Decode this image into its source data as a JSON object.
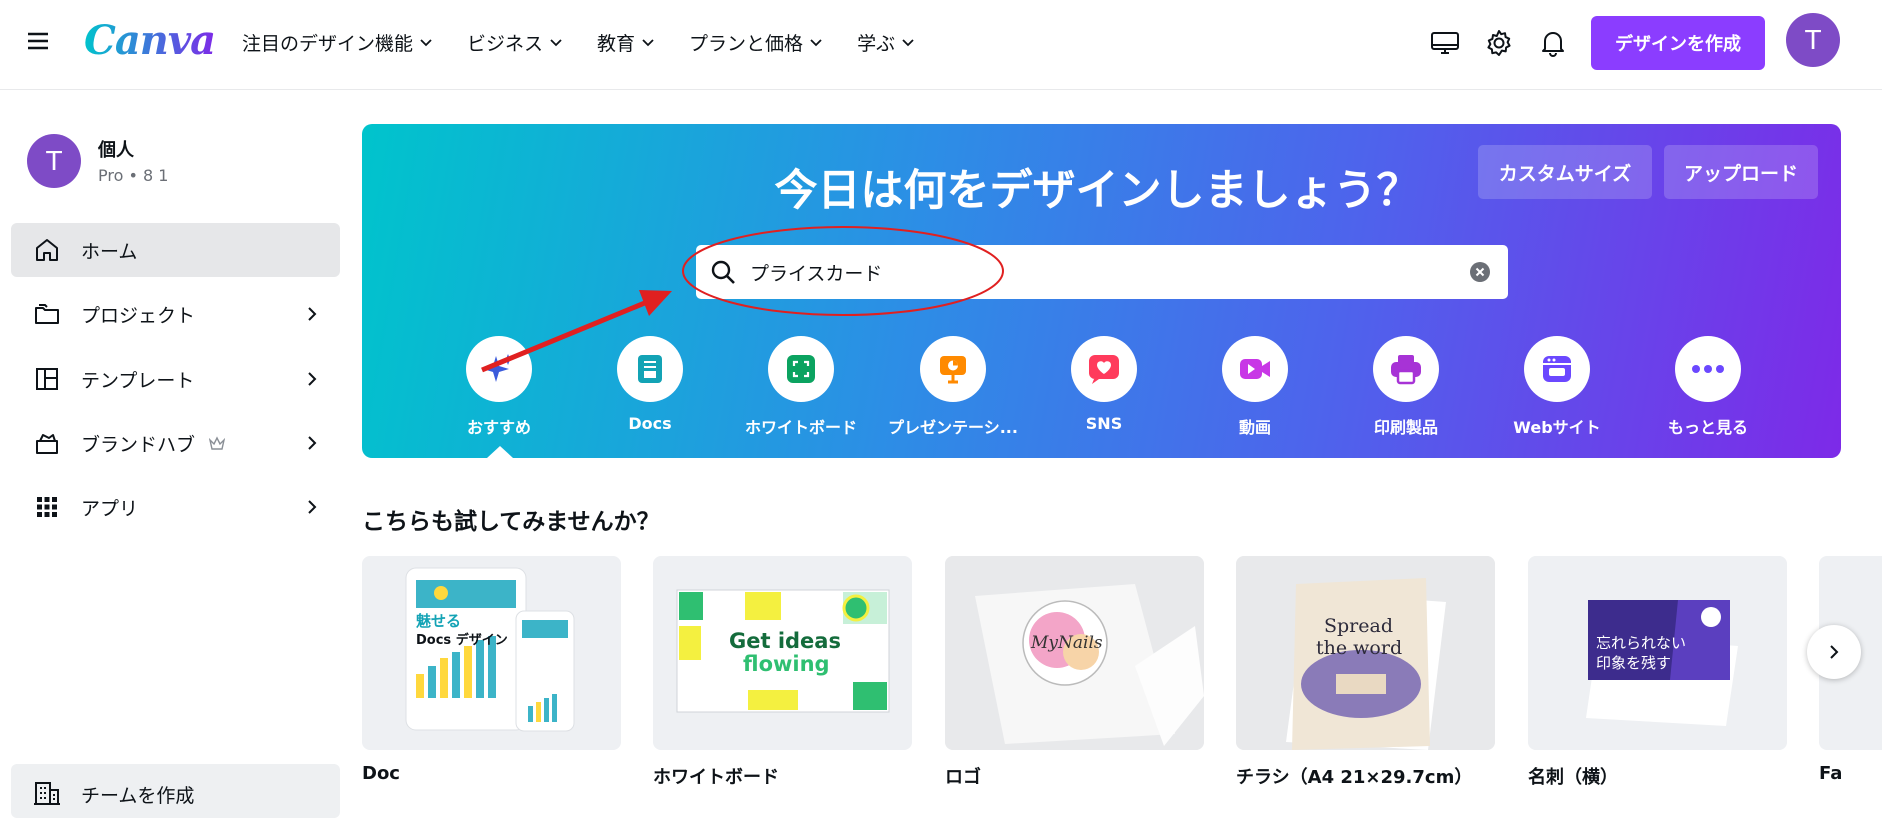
{
  "header": {
    "logo": "Canva",
    "nav": [
      "注目のデザイン機能",
      "ビジネス",
      "教育",
      "プランと価格",
      "学ぶ"
    ],
    "create_button": "デザインを作成",
    "avatar_initial": "T"
  },
  "sidebar": {
    "account": {
      "initial": "T",
      "name": "個人",
      "plan": "Pro • 8 1"
    },
    "items": [
      {
        "label": "ホーム",
        "icon": "home-icon",
        "active": true
      },
      {
        "label": "プロジェクト",
        "icon": "folder-icon"
      },
      {
        "label": "テンプレート",
        "icon": "template-icon"
      },
      {
        "label": "ブランドハブ",
        "icon": "brand-hub-icon"
      },
      {
        "label": "アプリ",
        "icon": "apps-grid-icon"
      }
    ],
    "team_button": "チームを作成"
  },
  "hero": {
    "title": "今日は何をデザインしましょう？",
    "custom_size": "カスタムサイズ",
    "upload": "アップロード",
    "search_value": "プライスカード",
    "categories": [
      {
        "label": "おすすめ",
        "color": "#3b5bdb",
        "icon": "sparkle-icon"
      },
      {
        "label": "Docs",
        "color": "#13a3b5",
        "icon": "docs-icon"
      },
      {
        "label": "ホワイトボード",
        "color": "#0ba360",
        "icon": "whiteboard-icon"
      },
      {
        "label": "プレゼンテーシ...",
        "color": "#ff8a00",
        "icon": "presentation-icon"
      },
      {
        "label": "SNS",
        "color": "#ff3b5c",
        "icon": "heart-icon"
      },
      {
        "label": "動画",
        "color": "#c837e6",
        "icon": "video-icon"
      },
      {
        "label": "印刷製品",
        "color": "#a733d6",
        "icon": "printer-icon"
      },
      {
        "label": "Webサイト",
        "color": "#6b48ff",
        "icon": "browser-icon"
      },
      {
        "label": "もっと見る",
        "color": "#6b48ff",
        "icon": "more-icon"
      }
    ]
  },
  "suggestions": {
    "title": "こちらも試してみませんか？",
    "cards": [
      {
        "label": "Doc",
        "thumb_title": "魅せる",
        "thumb_sub": "Docs デザイン"
      },
      {
        "label": "ホワイトボード",
        "thumb_title": "Get ideas",
        "thumb_sub": "flowing"
      },
      {
        "label": "ロゴ",
        "thumb_title": "MyNails",
        "thumb_sub": ""
      },
      {
        "label": "チラシ（A4 21×29.7cm）",
        "thumb_title": "Spread",
        "thumb_sub": "the word"
      },
      {
        "label": "名刺（横）",
        "thumb_title": "忘れられない",
        "thumb_sub": "印象を残す"
      },
      {
        "label": "Fa"
      }
    ]
  },
  "colors": {
    "brand_purple": "#8b3dff",
    "annotation_red": "#e02020"
  }
}
